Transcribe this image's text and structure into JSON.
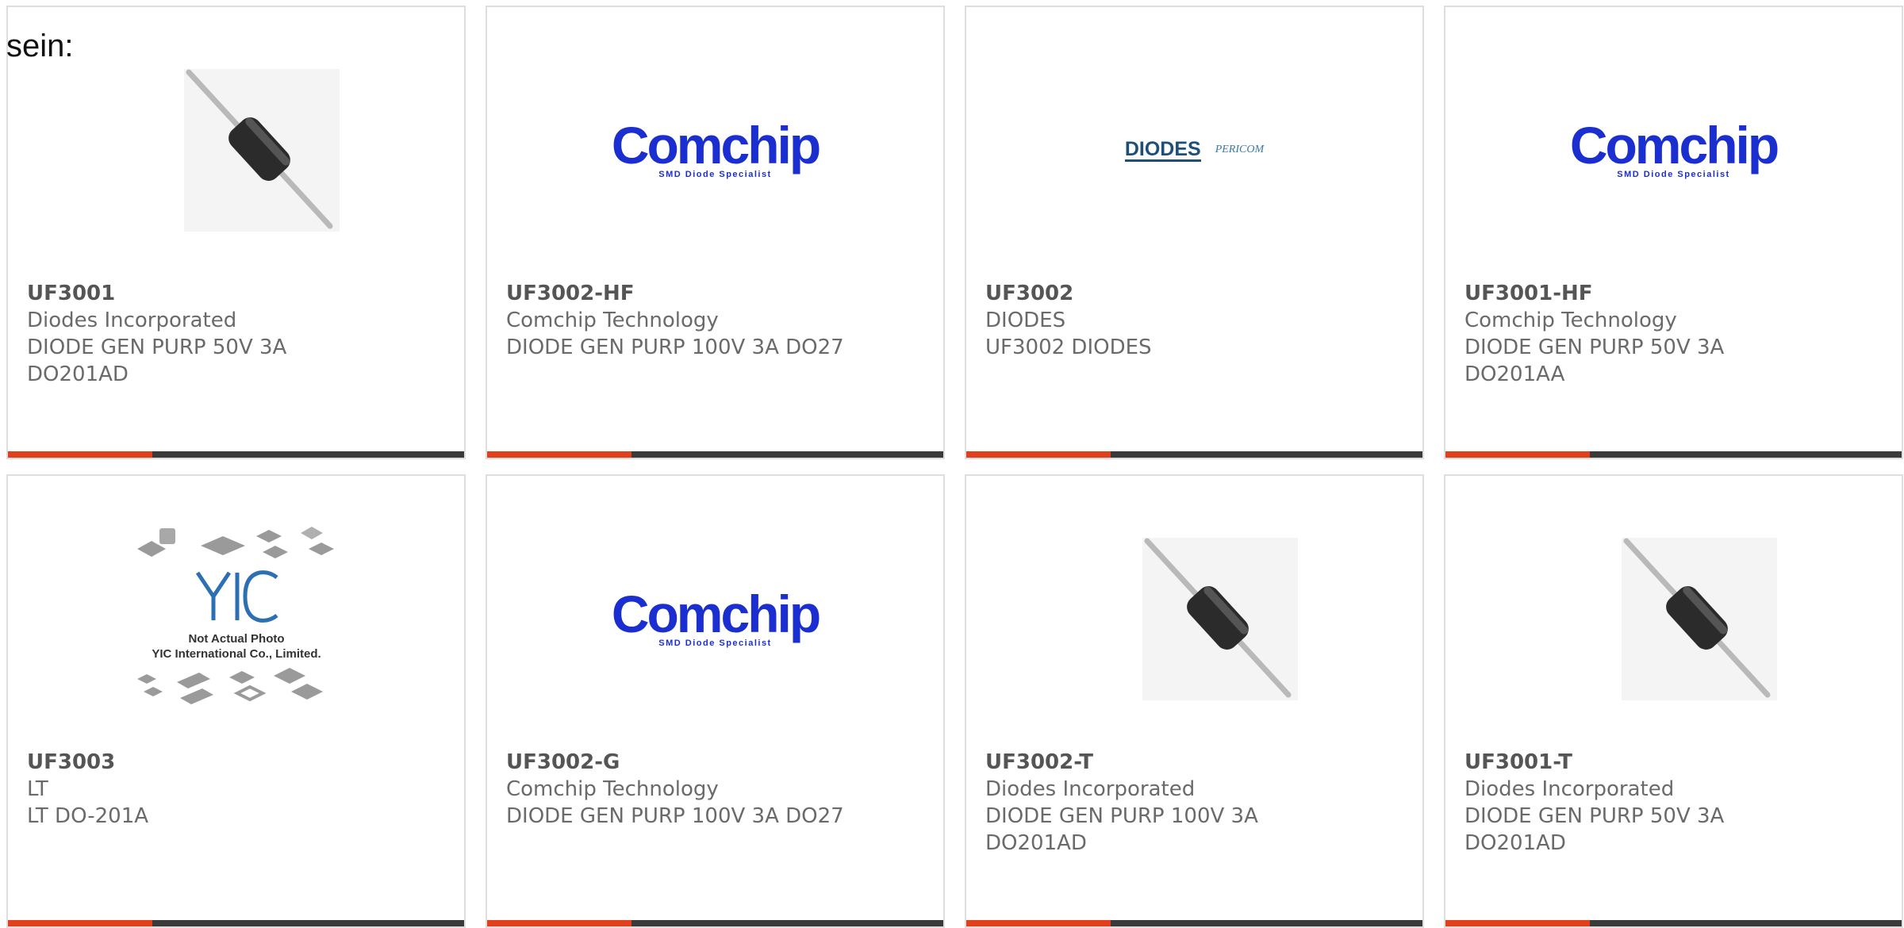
{
  "intro_text": "sein:",
  "products": [
    {
      "part": "UF3001",
      "manufacturer": "Diodes Incorporated",
      "desc_lines": [
        "DIODE GEN PURP 50V 3A",
        "DO201AD"
      ],
      "image": "axial-diode-photo"
    },
    {
      "part": "UF3002-HF",
      "manufacturer": "Comchip Technology",
      "desc_lines": [
        "DIODE GEN PURP 100V 3A DO27"
      ],
      "image": "comchip-logo"
    },
    {
      "part": "UF3002",
      "manufacturer": "DIODES",
      "desc_lines": [
        "UF3002 DIODES"
      ],
      "image": "diodes-pericom-logo"
    },
    {
      "part": "UF3001-HF",
      "manufacturer": "Comchip Technology",
      "desc_lines": [
        "DIODE GEN PURP 50V 3A",
        "DO201AA"
      ],
      "image": "comchip-logo"
    },
    {
      "part": "UF3003",
      "manufacturer": "LT",
      "desc_lines": [
        "LT DO-201A"
      ],
      "image": "yic-placeholder"
    },
    {
      "part": "UF3002-G",
      "manufacturer": "Comchip Technology",
      "desc_lines": [
        "DIODE GEN PURP 100V 3A DO27"
      ],
      "image": "comchip-logo"
    },
    {
      "part": "UF3002-T",
      "manufacturer": "Diodes Incorporated",
      "desc_lines": [
        "DIODE GEN PURP 100V 3A",
        "DO201AD"
      ],
      "image": "axial-diode-photo"
    },
    {
      "part": "UF3001-T",
      "manufacturer": "Diodes Incorporated",
      "desc_lines": [
        "DIODE GEN PURP 50V 3A",
        "DO201AD"
      ],
      "image": "axial-diode-photo"
    }
  ],
  "logos": {
    "comchip_word": "Comchip",
    "comchip_tagline": "SMD Diode Specialist",
    "diodes_word": "DIODES",
    "pericom_word": "PERICOM",
    "yic_letters": "YIC",
    "yic_caption_1": "Not Actual Photo",
    "yic_caption_2": "YIC International Co., Limited."
  },
  "colors": {
    "accent_red": "#e0401c",
    "accent_dark": "#3a3a3a",
    "comchip_blue": "#1b2fd0",
    "diodes_blue": "#1d4f7c"
  }
}
